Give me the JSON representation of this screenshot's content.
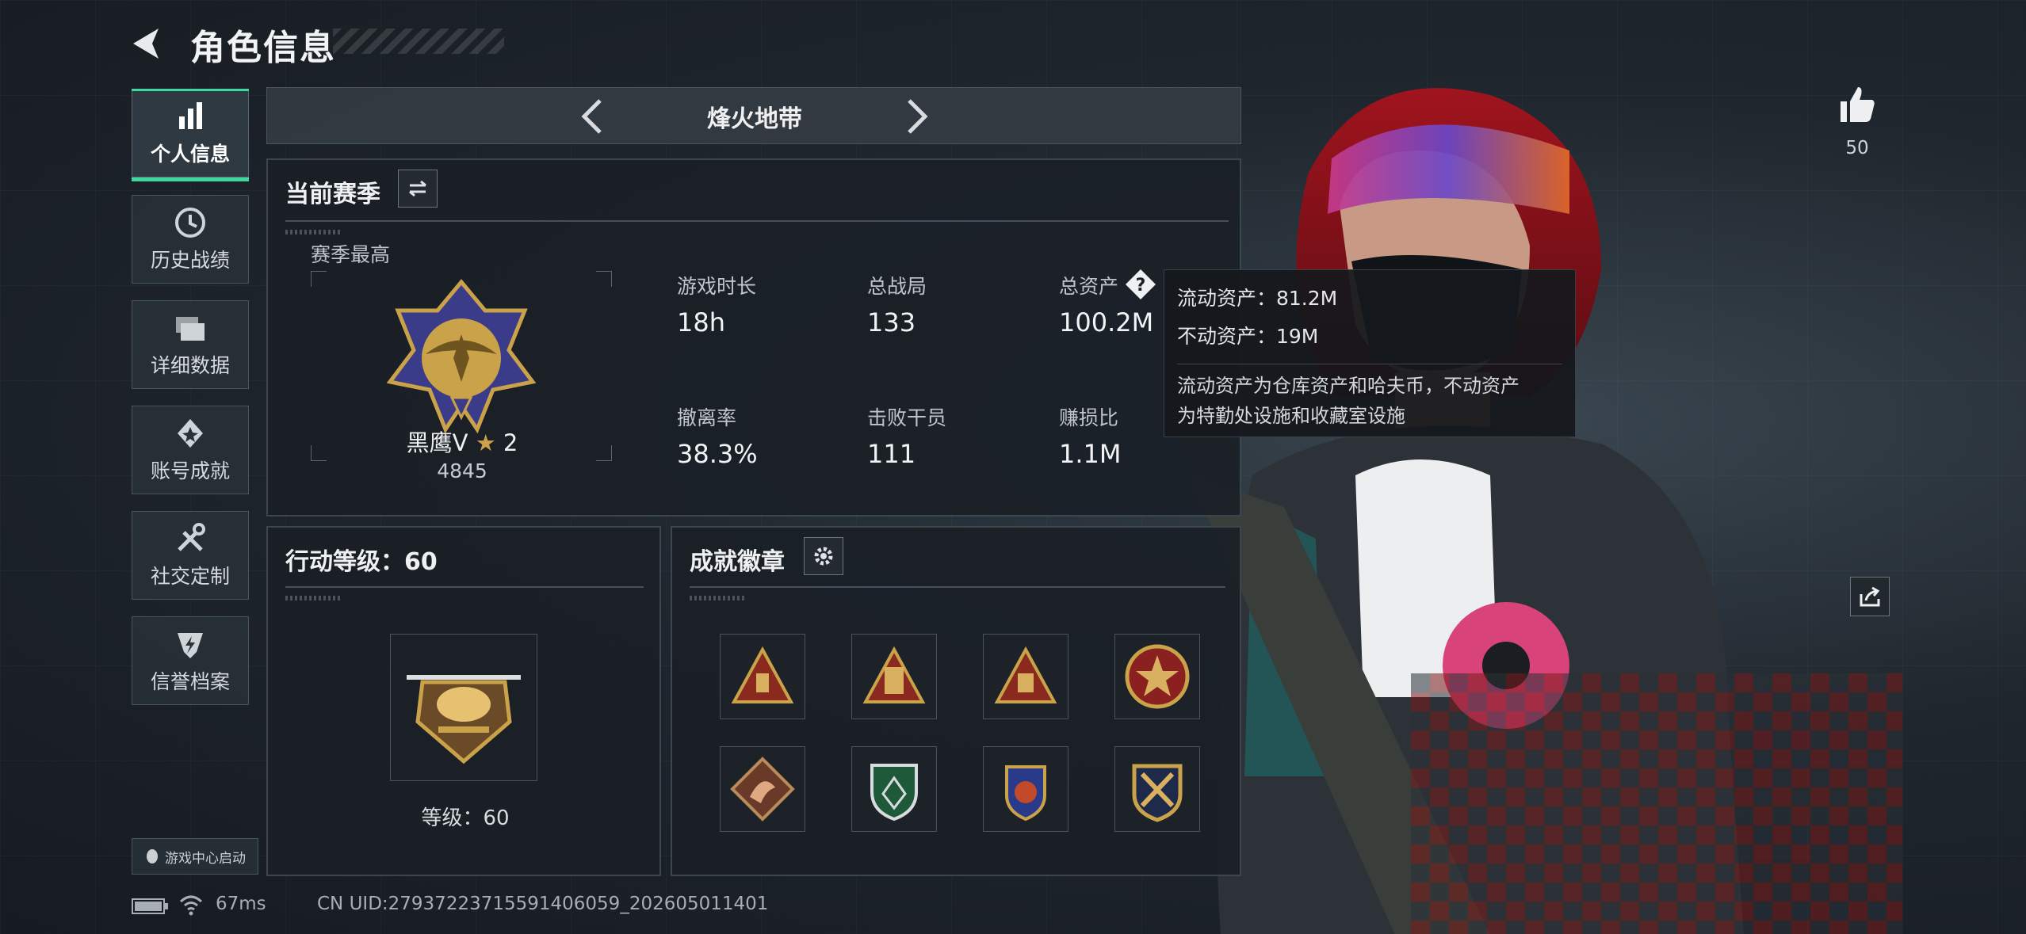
{
  "header": {
    "title": "角色信息"
  },
  "sidebar": {
    "items": [
      {
        "label": "个人信息",
        "icon": "bar-chart-icon",
        "active": true
      },
      {
        "label": "历史战绩",
        "icon": "clock-history-icon",
        "active": false
      },
      {
        "label": "详细数据",
        "icon": "folders-icon",
        "active": false
      },
      {
        "label": "账号成就",
        "icon": "achievement-star-icon",
        "active": false
      },
      {
        "label": "社交定制",
        "icon": "tools-icon",
        "active": false
      },
      {
        "label": "信誉档案",
        "icon": "shield-bolt-icon",
        "active": false
      }
    ],
    "launch_label": "游戏中心启动"
  },
  "mode": {
    "title": "烽火地带"
  },
  "season": {
    "title": "当前赛季",
    "best_label": "赛季最高",
    "rank_name": "黑鹰V",
    "rank_stars": "2",
    "rank_score": "4845",
    "stats": [
      {
        "label": "游戏时长",
        "value": "18h"
      },
      {
        "label": "总战局",
        "value": "133"
      },
      {
        "label": "总资产",
        "value": "100.2M"
      },
      {
        "label": "撤离率",
        "value": "38.3%"
      },
      {
        "label": "击败干员",
        "value": "111"
      },
      {
        "label": "赚损比",
        "value": "1.1M"
      }
    ]
  },
  "tooltip": {
    "liquid": "流动资产：81.2M",
    "fixed": "不动资产：19M",
    "note_line1": "流动资产为仓库资产和哈夫币，不动资产",
    "note_line2": "为特勤处设施和收藏室设施"
  },
  "action_level": {
    "title": "行动等级：60",
    "level_label": "等级：60"
  },
  "badges": {
    "title": "成就徽章",
    "items": [
      "triangle-badge-icon",
      "triangle-badge-icon",
      "triangle-badge-icon",
      "star-medal-icon",
      "dragon-badge-icon",
      "shield-badge-icon",
      "wing-shield-badge-icon",
      "crossed-swords-badge-icon"
    ]
  },
  "likes": {
    "count": "50"
  },
  "footer": {
    "ping": "67ms",
    "uid": "CN UID:279372237155914060​59_202605011401"
  },
  "colors": {
    "accent": "#3fd8a0",
    "panel_border": "#3c464e",
    "gold": "#c9a24a"
  }
}
